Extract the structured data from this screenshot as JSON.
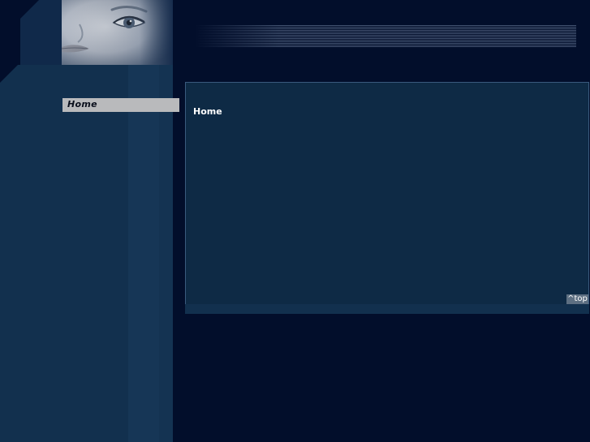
{
  "nav": {
    "items": [
      {
        "label": "Home"
      }
    ]
  },
  "content": {
    "title": "Home",
    "top_link": "^top"
  },
  "colors": {
    "background": "#020e2b",
    "sidebar": "#12304e",
    "content_panel": "#0e2a45",
    "nav_item_active": "#b9babc",
    "top_link_bg": "#5d6f82"
  },
  "icons": {
    "banner": "face-photo"
  }
}
